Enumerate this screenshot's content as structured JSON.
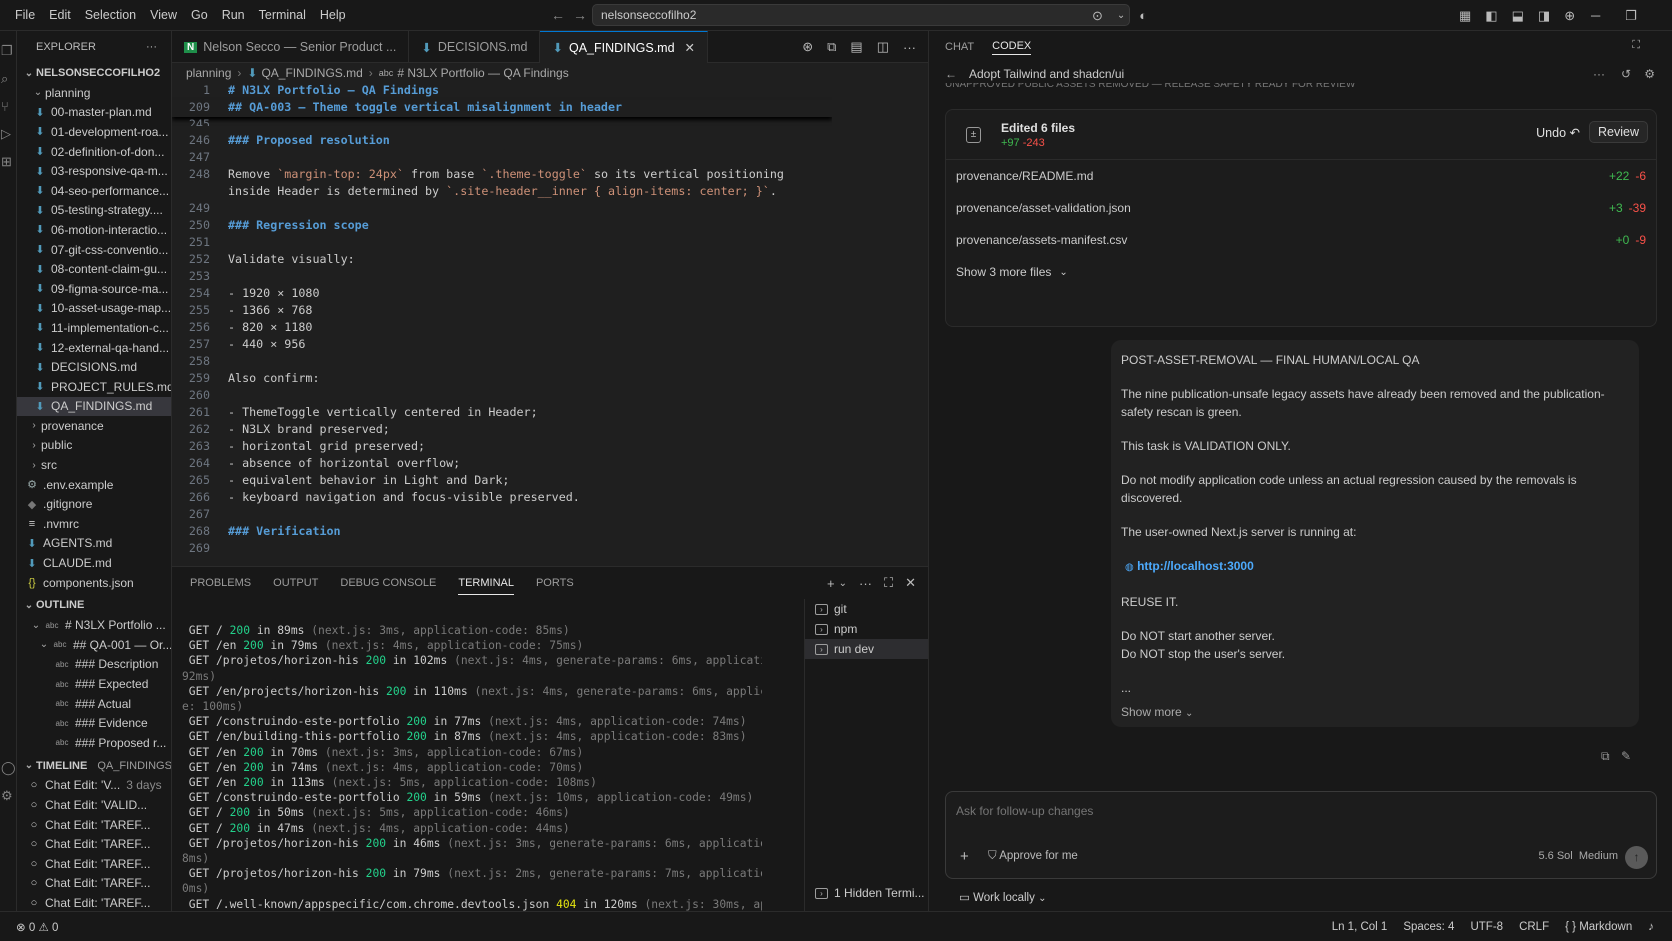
{
  "menu": [
    "File",
    "Edit",
    "Selection",
    "View",
    "Go",
    "Run",
    "Terminal",
    "Help"
  ],
  "command_center": "nelsonseccofilho2",
  "explorer": {
    "title": "EXPLORER",
    "root": "NELSONSECCOFILHO2",
    "planning_label": "planning",
    "planning_files": [
      "00-master-plan.md",
      "01-development-roa...",
      "02-definition-of-don...",
      "03-responsive-qa-m...",
      "04-seo-performance...",
      "05-testing-strategy....",
      "06-motion-interactio...",
      "07-git-css-conventio...",
      "08-content-claim-gu...",
      "09-figma-source-ma...",
      "10-asset-usage-map...",
      "11-implementation-c...",
      "12-external-qa-hand...",
      "DECISIONS.md",
      "PROJECT_RULES.md",
      "QA_FINDINGS.md"
    ],
    "folders": [
      "provenance",
      "public",
      "src"
    ],
    "root_files": [
      ".env.example",
      ".gitignore",
      ".nvmrc",
      "AGENTS.md",
      "CLAUDE.md",
      "components.json"
    ]
  },
  "outline": {
    "title": "OUTLINE",
    "items": [
      "# N3LX Portfolio ...",
      "## QA-001 — Or...",
      "### Description",
      "### Expected",
      "### Actual",
      "### Evidence",
      "### Proposed r..."
    ]
  },
  "timeline": {
    "title": "TIMELINE",
    "file": "QA_FINDINGS.md",
    "items": [
      {
        "label": "Chat Edit: 'V...",
        "time": "3 days"
      },
      {
        "label": "Chat Edit: 'VALID...",
        "time": ""
      },
      {
        "label": "Chat Edit: 'TAREF...",
        "time": ""
      },
      {
        "label": "Chat Edit: 'TAREF...",
        "time": ""
      },
      {
        "label": "Chat Edit: 'TAREF...",
        "time": ""
      },
      {
        "label": "Chat Edit: 'TAREF...",
        "time": ""
      },
      {
        "label": "Chat Edit: 'TAREF...",
        "time": ""
      },
      {
        "label": "Chat Edit: 'TAREF...",
        "time": ""
      }
    ]
  },
  "tabs": [
    "Nelson Secco — Senior Product ...",
    "DECISIONS.md",
    "QA_FINDINGS.md"
  ],
  "breadcrumb": [
    "planning",
    "QA_FINDINGS.md",
    "# N3LX Portfolio — QA Findings"
  ],
  "code": [
    {
      "n": "1",
      "text": "# N3LX Portfolio — QA Findings",
      "kind": "h"
    },
    {
      "n": "209",
      "text": "## QA-003 — Theme toggle vertical misalignment in header",
      "kind": "h"
    },
    {
      "n": "245",
      "text": "",
      "kind": "t"
    },
    {
      "n": "246",
      "text": "### Proposed resolution",
      "kind": "h"
    },
    {
      "n": "247",
      "text": "",
      "kind": "t"
    },
    {
      "n": "248",
      "text": "Remove `margin-top: 24px` from base `.theme-toggle` so its vertical positioning",
      "kind": "t"
    },
    {
      "n": "",
      "text": "inside Header is determined by `.site-header__inner { align-items: center; }`.",
      "kind": "t"
    },
    {
      "n": "249",
      "text": "",
      "kind": "t"
    },
    {
      "n": "250",
      "text": "### Regression scope",
      "kind": "h"
    },
    {
      "n": "251",
      "text": "",
      "kind": "t"
    },
    {
      "n": "252",
      "text": "Validate visually:",
      "kind": "t"
    },
    {
      "n": "253",
      "text": "",
      "kind": "t"
    },
    {
      "n": "254",
      "text": "- 1920 × 1080",
      "kind": "t"
    },
    {
      "n": "255",
      "text": "- 1366 × 768",
      "kind": "t"
    },
    {
      "n": "256",
      "text": "- 820 × 1180",
      "kind": "t"
    },
    {
      "n": "257",
      "text": "- 440 × 956",
      "kind": "t"
    },
    {
      "n": "258",
      "text": "",
      "kind": "t"
    },
    {
      "n": "259",
      "text": "Also confirm:",
      "kind": "t"
    },
    {
      "n": "260",
      "text": "",
      "kind": "t"
    },
    {
      "n": "261",
      "text": "- ThemeToggle vertically centered in Header;",
      "kind": "t"
    },
    {
      "n": "262",
      "text": "- N3LX brand preserved;",
      "kind": "t"
    },
    {
      "n": "263",
      "text": "- horizontal grid preserved;",
      "kind": "t"
    },
    {
      "n": "264",
      "text": "- absence of horizontal overflow;",
      "kind": "t"
    },
    {
      "n": "265",
      "text": "- equivalent behavior in Light and Dark;",
      "kind": "t"
    },
    {
      "n": "266",
      "text": "- keyboard navigation and focus-visible preserved.",
      "kind": "t"
    },
    {
      "n": "267",
      "text": "",
      "kind": "t"
    },
    {
      "n": "268",
      "text": "### Verification",
      "kind": "h"
    },
    {
      "n": "269",
      "text": "",
      "kind": "t"
    }
  ],
  "panel_tabs": [
    "PROBLEMS",
    "OUTPUT",
    "DEBUG CONSOLE",
    "TERMINAL",
    "PORTS"
  ],
  "terminal_lines": [
    {
      "pre": " GET / ",
      "code": "200",
      "c": "g",
      "mid": " in 89ms ",
      "dim": "(next.js: 3ms, application-code: 85ms)"
    },
    {
      "pre": " GET /en ",
      "code": "200",
      "c": "g",
      "mid": " in 79ms ",
      "dim": "(next.js: 4ms, application-code: 75ms)"
    },
    {
      "pre": " GET /projetos/horizon-his ",
      "code": "200",
      "c": "g",
      "mid": " in 102ms ",
      "dim": "(next.js: 4ms, generate-params: 6ms, application-code:"
    },
    {
      "pre": "",
      "code": "",
      "c": "g",
      "mid": "",
      "dim": "92ms)"
    },
    {
      "pre": " GET /en/projects/horizon-his ",
      "code": "200",
      "c": "g",
      "mid": " in 110ms ",
      "dim": "(next.js: 4ms, generate-params: 6ms, application-cod"
    },
    {
      "pre": "",
      "code": "",
      "c": "g",
      "mid": "",
      "dim": "e: 100ms)"
    },
    {
      "pre": " GET /construindo-este-portfolio ",
      "code": "200",
      "c": "g",
      "mid": " in 77ms ",
      "dim": "(next.js: 4ms, application-code: 74ms)"
    },
    {
      "pre": " GET /en/building-this-portfolio ",
      "code": "200",
      "c": "g",
      "mid": " in 87ms ",
      "dim": "(next.js: 4ms, application-code: 83ms)"
    },
    {
      "pre": " GET /en ",
      "code": "200",
      "c": "g",
      "mid": " in 70ms ",
      "dim": "(next.js: 3ms, application-code: 67ms)"
    },
    {
      "pre": " GET /en ",
      "code": "200",
      "c": "g",
      "mid": " in 74ms ",
      "dim": "(next.js: 4ms, application-code: 70ms)"
    },
    {
      "pre": " GET /en ",
      "code": "200",
      "c": "g",
      "mid": " in 113ms ",
      "dim": "(next.js: 5ms, application-code: 108ms)"
    },
    {
      "pre": " GET /construindo-este-portfolio ",
      "code": "200",
      "c": "g",
      "mid": " in 59ms ",
      "dim": "(next.js: 10ms, application-code: 49ms)"
    },
    {
      "pre": " GET / ",
      "code": "200",
      "c": "g",
      "mid": " in 50ms ",
      "dim": "(next.js: 5ms, application-code: 46ms)"
    },
    {
      "pre": " GET / ",
      "code": "200",
      "c": "g",
      "mid": " in 47ms ",
      "dim": "(next.js: 4ms, application-code: 44ms)"
    },
    {
      "pre": " GET /projetos/horizon-his ",
      "code": "200",
      "c": "g",
      "mid": " in 46ms ",
      "dim": "(next.js: 3ms, generate-params: 6ms, application-code: 3"
    },
    {
      "pre": "",
      "code": "",
      "c": "g",
      "mid": "",
      "dim": "8ms)"
    },
    {
      "pre": " GET /projetos/horizon-his ",
      "code": "200",
      "c": "g",
      "mid": " in 79ms ",
      "dim": "(next.js: 2ms, generate-params: 7ms, application-code: 7"
    },
    {
      "pre": "",
      "code": "",
      "c": "g",
      "mid": "",
      "dim": "0ms)"
    },
    {
      "pre": " GET /.well-known/appspecific/com.chrome.devtools.json ",
      "code": "404",
      "c": "y",
      "mid": " in 120ms ",
      "dim": "(next.js: 30ms, application"
    }
  ],
  "terminals": [
    "git",
    "npm",
    "run dev"
  ],
  "hidden_terminals": "1 Hidden Termi...",
  "chat": {
    "tabs": [
      "CHAT",
      "CODEX"
    ],
    "title": "Adopt Tailwind and shadcn/ui",
    "cut_line": "UNAPPROVED PUBLIC ASSETS REMOVED — RELEASE SAFETY READY FOR REVIEW",
    "edited_label": "Edited 6 files",
    "edited_add": "+97",
    "edited_del": "-243",
    "undo_label": "Undo",
    "review_label": "Review",
    "files": [
      {
        "path": "provenance/README.md",
        "add": "+22",
        "del": "-6"
      },
      {
        "path": "provenance/asset-validation.json",
        "add": "+3",
        "del": "-39"
      },
      {
        "path": "provenance/assets-manifest.csv",
        "add": "+0",
        "del": "-9"
      }
    ],
    "show_more_files": "Show 3 more files",
    "message": [
      "POST-ASSET-REMOVAL — FINAL HUMAN/LOCAL QA",
      "The nine publication-unsafe legacy assets have already been removed and the publication-safety rescan is green.",
      "This task is VALIDATION ONLY.",
      "Do not modify application code unless an actual regression caused by the removals is discovered.",
      "The user-owned Next.js server is running at:"
    ],
    "link": "http://localhost:3000",
    "reuse": "REUSE IT.",
    "no_start": "Do NOT start another server.",
    "no_stop": "Do NOT stop the user's server.",
    "ellipsis": "...",
    "show_more": "Show more",
    "placeholder": "Ask for follow-up changes",
    "approve": "Approve for me",
    "model": "5.6 Sol",
    "effort": "Medium",
    "work_locally": "Work locally"
  },
  "status": {
    "problems": "0",
    "warnings": "0",
    "position": "Ln 1, Col 1",
    "spaces": "Spaces: 4",
    "encoding": "UTF-8",
    "eol": "CRLF",
    "language": "Markdown"
  },
  "colors": {
    "accent": "#0078d4",
    "link": "#4daafc",
    "added": "#3fb950",
    "deleted": "#f85149",
    "heading": "#569cd6"
  }
}
